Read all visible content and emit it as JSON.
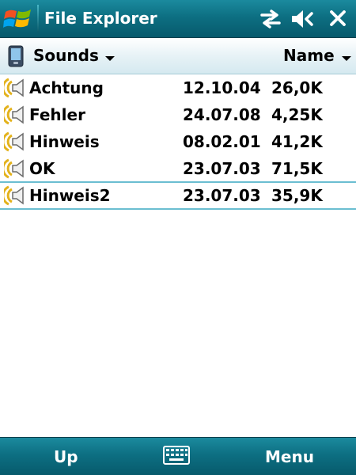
{
  "titlebar": {
    "app_title": "File Explorer",
    "icons": [
      "windows-logo",
      "connectivity-icon",
      "volume-muted-icon",
      "close-icon"
    ],
    "close_glyph": "✕"
  },
  "location": {
    "folder": "Sounds",
    "sort_by": "Name"
  },
  "files": [
    {
      "name": "Achtung",
      "date": "12.10.04",
      "size": "26,0K",
      "selected": false
    },
    {
      "name": "Fehler",
      "date": "24.07.08",
      "size": "4,25K",
      "selected": false
    },
    {
      "name": "Hinweis",
      "date": "08.02.01",
      "size": "41,2K",
      "selected": false
    },
    {
      "name": "OK",
      "date": "23.07.03",
      "size": "71,5K",
      "selected": false
    },
    {
      "name": "Hinweis2",
      "date": "23.07.03",
      "size": "35,9K",
      "selected": true
    }
  ],
  "softkeys": {
    "left": "Up",
    "right": "Menu",
    "center_icon": "keyboard-icon"
  },
  "colors": {
    "bar": "#0d6f82",
    "selection_outline": "#6bbed1",
    "icon_gold": "#e3b21c"
  }
}
